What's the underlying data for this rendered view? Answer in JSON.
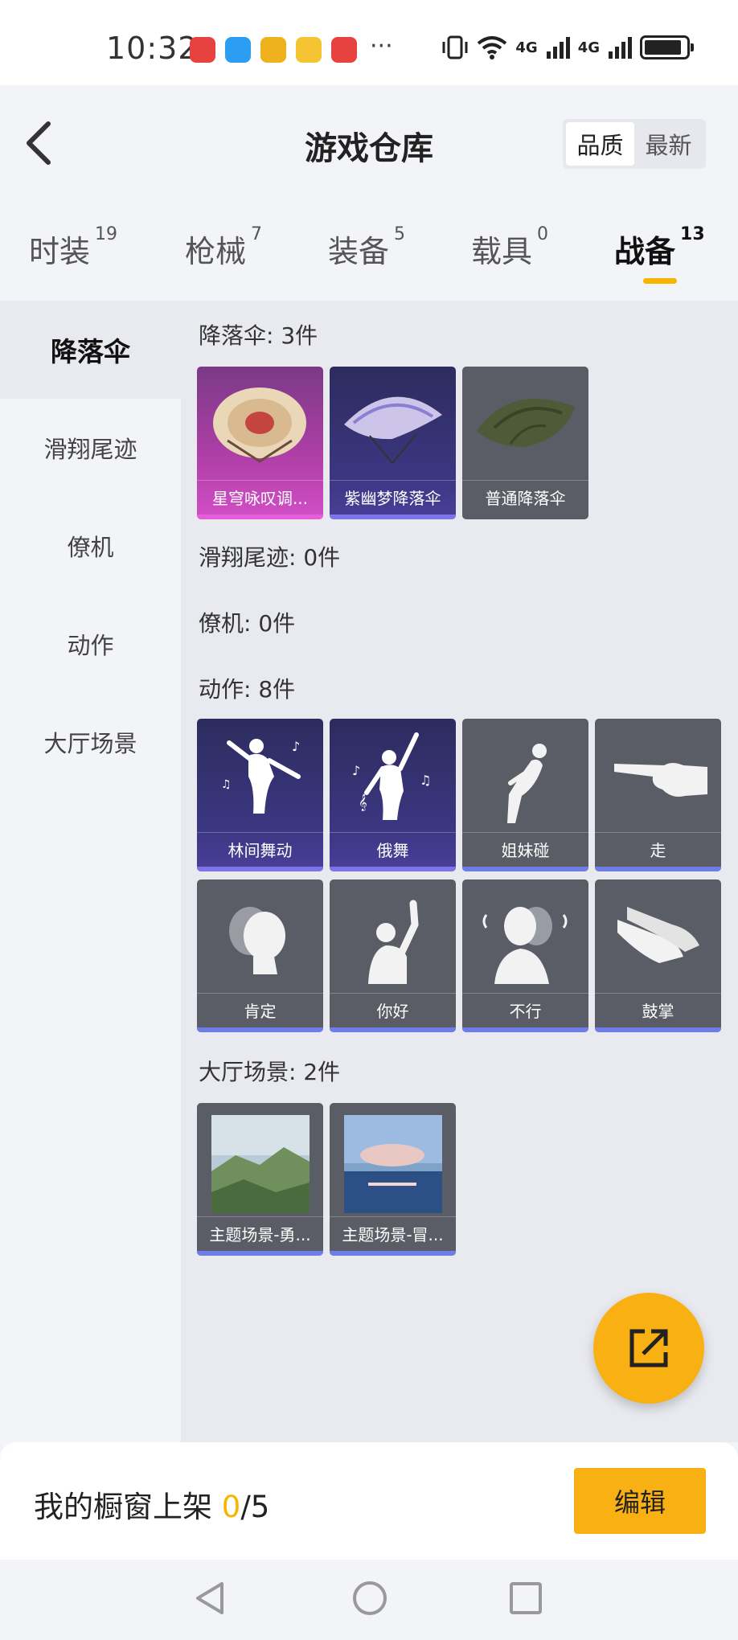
{
  "status_bar": {
    "time": "10:32",
    "more": "···",
    "network1": "4G",
    "network2": "4G",
    "icons": [
      "signal-vibrate-icon",
      "wifi-icon",
      "signal-bars-icon",
      "signal-bars-icon",
      "battery-icon"
    ]
  },
  "header": {
    "title": "游戏仓库",
    "sort_options": [
      "品质",
      "最新"
    ],
    "sort_selected": "品质"
  },
  "tabs": [
    {
      "label": "时装",
      "count": "19"
    },
    {
      "label": "枪械",
      "count": "7"
    },
    {
      "label": "装备",
      "count": "5"
    },
    {
      "label": "载具",
      "count": "0"
    },
    {
      "label": "战备",
      "count": "13"
    }
  ],
  "active_tab": "战备",
  "sidebar": {
    "items": [
      "降落伞",
      "滑翔尾迹",
      "僚机",
      "动作",
      "大厅场景"
    ],
    "selected": "降落伞"
  },
  "sections": {
    "parachute": {
      "title": "降落伞: 3件",
      "items": [
        "星穹咏叹调...",
        "紫幽梦降落伞",
        "普通降落伞"
      ]
    },
    "glide_trail": {
      "title": "滑翔尾迹: 0件"
    },
    "wingman": {
      "title": "僚机: 0件"
    },
    "emote": {
      "title": "动作: 8件",
      "items": [
        "林间舞动",
        "俄舞",
        "姐妹碰",
        "走",
        "肯定",
        "你好",
        "不行",
        "鼓掌"
      ]
    },
    "lobby": {
      "title": "大厅场景: 2件",
      "items": [
        "主题场景-勇...",
        "主题场景-冒..."
      ]
    }
  },
  "bottom": {
    "label": "我的橱窗上架",
    "current": "0",
    "total": "/5",
    "edit_label": "编辑"
  },
  "colors": {
    "accent": "#f9b012",
    "tab_underline": "#f7b500",
    "rarity_pink": "#d24fc6",
    "rarity_purple": "#4a3f9a",
    "rarity_blue": "#6f7de6"
  }
}
